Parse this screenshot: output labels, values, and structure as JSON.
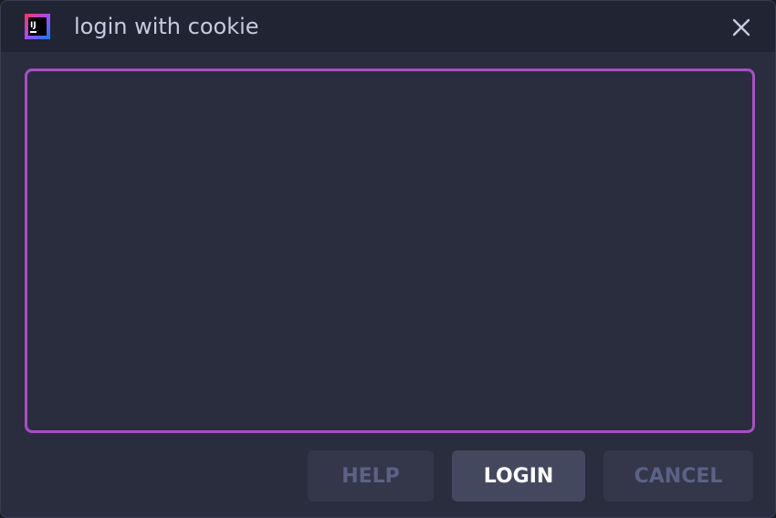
{
  "window": {
    "title": "login with cookie",
    "app_icon": "intellij-idea-icon",
    "app_icon_text": "IJ",
    "close_icon": "close-icon"
  },
  "cookie_input": {
    "value": "",
    "placeholder": ""
  },
  "buttons": {
    "help_label": "HELP",
    "login_label": "LOGIN",
    "cancel_label": "CANCEL"
  },
  "colors": {
    "dialog_background": "#2a2d3e",
    "titlebar_background": "#212432",
    "input_border": "#a84fc4",
    "primary_button": "#44485f",
    "secondary_button": "#333749",
    "secondary_button_text": "#5c6187"
  }
}
